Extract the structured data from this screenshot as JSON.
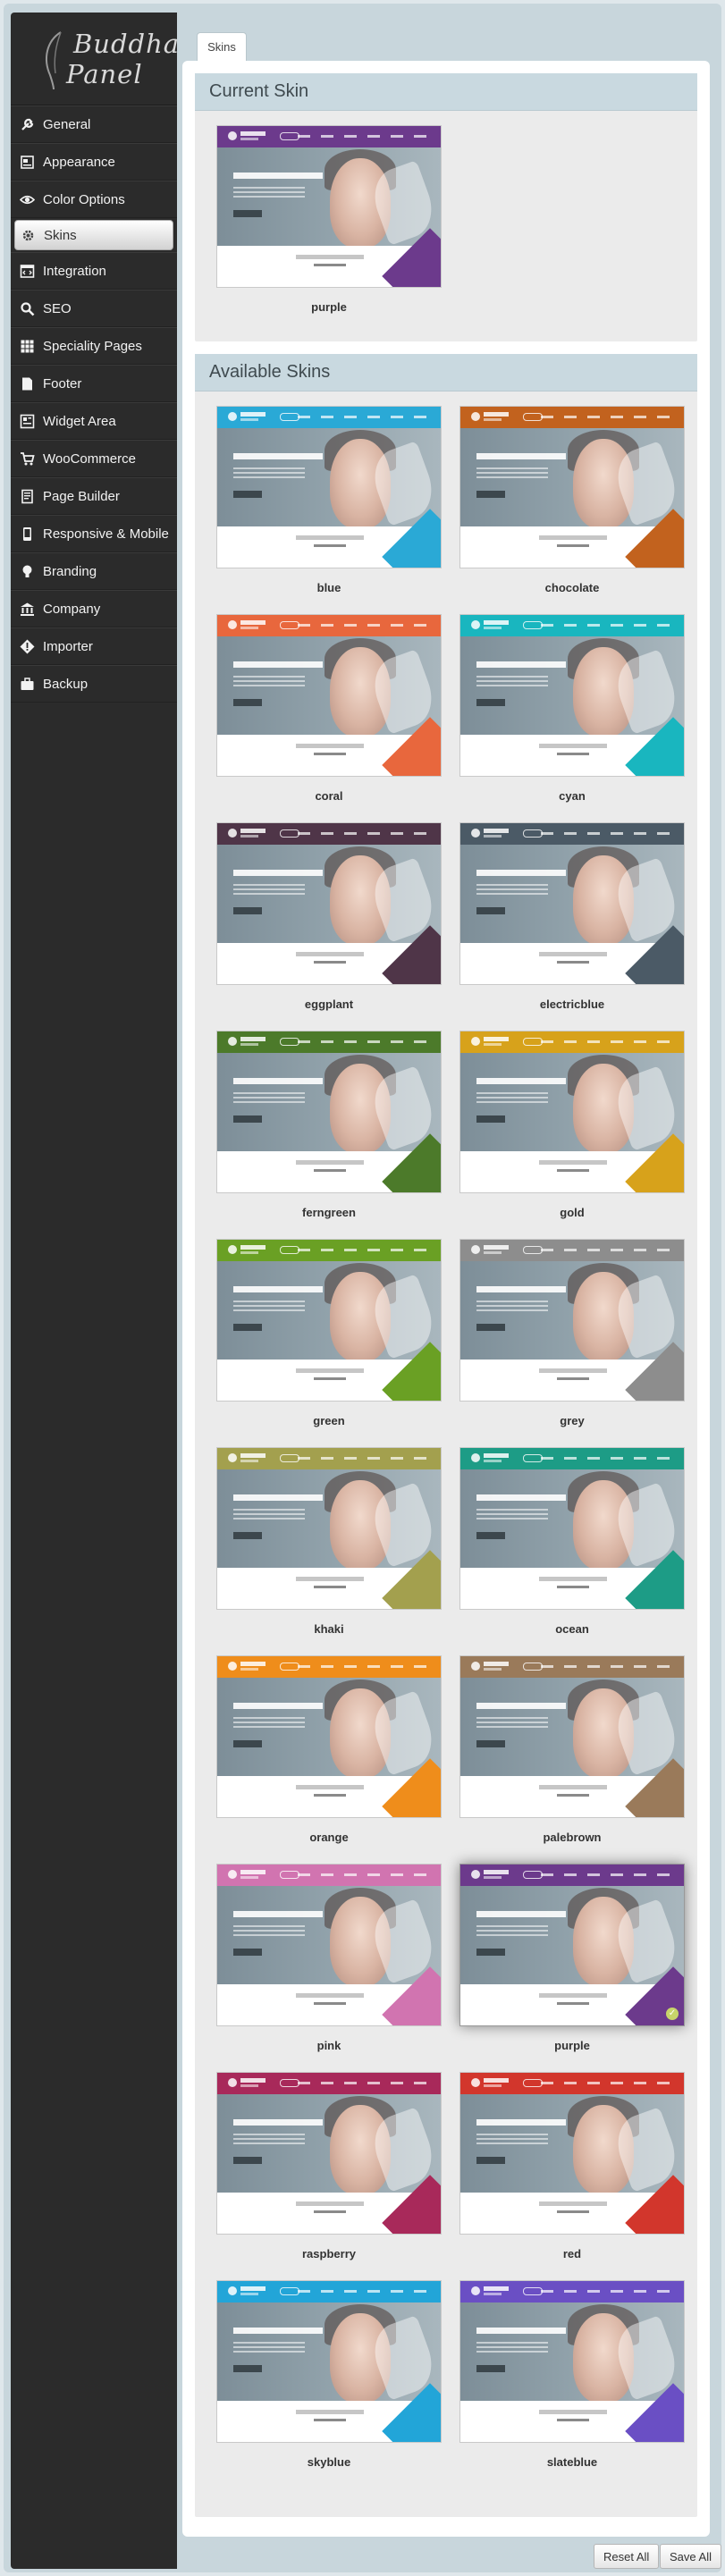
{
  "brand": {
    "line1": "Buddha",
    "line2": "Panel"
  },
  "sidebar": {
    "items": [
      {
        "label": "General",
        "icon": "wrench-icon"
      },
      {
        "label": "Appearance",
        "icon": "layout-icon"
      },
      {
        "label": "Color Options",
        "icon": "eye-icon"
      },
      {
        "label": "Skins",
        "icon": "gear-icon",
        "active": true
      },
      {
        "label": "Integration",
        "icon": "code-window-icon"
      },
      {
        "label": "SEO",
        "icon": "search-icon"
      },
      {
        "label": "Speciality Pages",
        "icon": "grid-icon"
      },
      {
        "label": "Footer",
        "icon": "document-icon"
      },
      {
        "label": "Widget Area",
        "icon": "widgets-icon"
      },
      {
        "label": "WooCommerce",
        "icon": "cart-icon"
      },
      {
        "label": "Page Builder",
        "icon": "page-icon"
      },
      {
        "label": "Responsive & Mobile",
        "icon": "mobile-icon"
      },
      {
        "label": "Branding",
        "icon": "lightbulb-icon"
      },
      {
        "label": "Company",
        "icon": "bank-icon"
      },
      {
        "label": "Importer",
        "icon": "import-icon"
      },
      {
        "label": "Backup",
        "icon": "briefcase-icon"
      }
    ]
  },
  "tab": {
    "label": "Skins"
  },
  "current_skin": {
    "heading": "Current Skin",
    "name": "purple",
    "color": "#6c3a8c"
  },
  "available_skins": {
    "heading": "Available Skins",
    "skins": [
      {
        "name": "blue",
        "color": "#2aa9d6"
      },
      {
        "name": "chocolate",
        "color": "#c2621e"
      },
      {
        "name": "coral",
        "color": "#e8673d"
      },
      {
        "name": "cyan",
        "color": "#19b6bf"
      },
      {
        "name": "eggplant",
        "color": "#4f3548"
      },
      {
        "name": "electricblue",
        "color": "#4b5a66"
      },
      {
        "name": "ferngreen",
        "color": "#4c7a2a"
      },
      {
        "name": "gold",
        "color": "#d7a21b"
      },
      {
        "name": "green",
        "color": "#6aa024"
      },
      {
        "name": "grey",
        "color": "#8d8d8d"
      },
      {
        "name": "khaki",
        "color": "#a3a04e"
      },
      {
        "name": "ocean",
        "color": "#1d9c86"
      },
      {
        "name": "orange",
        "color": "#ef8d1b"
      },
      {
        "name": "palebrown",
        "color": "#9a7a5a"
      },
      {
        "name": "pink",
        "color": "#d174b0"
      },
      {
        "name": "purple",
        "color": "#6c3a8c",
        "selected": true
      },
      {
        "name": "raspberry",
        "color": "#a8295a"
      },
      {
        "name": "red",
        "color": "#d2362c"
      },
      {
        "name": "skyblue",
        "color": "#22a5d8"
      },
      {
        "name": "slateblue",
        "color": "#6a4fc4"
      }
    ]
  },
  "buttons": {
    "reset": "Reset All",
    "save": "Save All"
  }
}
